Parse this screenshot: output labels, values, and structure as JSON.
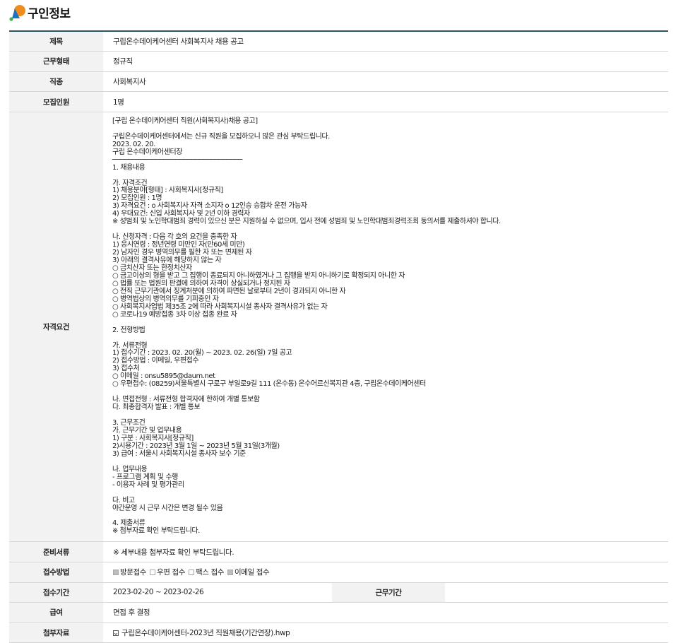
{
  "page": {
    "title": "구인정보"
  },
  "colors": {
    "header_border": "#2f5563",
    "label_bg": "#f2f2f2",
    "logo_orange": "#f28b1e",
    "logo_blue": "#1e73be",
    "logo_green": "#3bb34a"
  },
  "job": {
    "title_label": "제목",
    "title_value": "구립온수데이케어센터 사회복지사 채용 공고",
    "work_type_label": "근무형태",
    "work_type_value": "정규직",
    "occupation_label": "직종",
    "occupation_value": "사회복지사",
    "headcount_label": "모집인원",
    "headcount_value": "1명",
    "qualification_label": "자격요건",
    "qualification_text": "[구립 온수데이케어센터 직원(사회복지사)채용 공고]\n\n구립온수데이케어센터에서는 신규 직원을 모집하오니 많은 관심 부탁드립니다.\n2023. 02. 20.\n구립 온수데이케어센터장\n─────────────────────────────────\n1. 채용내용\n\n가. 자격조건\n1) 채용분야[형태] : 사회복지사[정규직]\n2) 모집인원 : 1명\n3) 자격요건 : o 사회복지사 자격 소지자 o 12인승 승합차 운전 가능자\n4) 우대요건: 신입 사회복지사 및 2년 이하 경력자\n※ 성범죄 및 노인학대범죄 경력이 있으신 분은 지원하실 수 없으며, 입사 전에 성범죄 및 노인학대범죄경력조회 동의서를 제출하셔야 합니다.\n\n나. 신청자격 : 다음 각 호의 요건을 충족한 자\n1) 응시연령 : 정년연령 미만인 자(만60세 미만)\n2) 남자인 경우 병역의무를 필한 자 또는 면제된 자\n3) 아래의 결격사유에 해당하지 않는 자\n○ 금치산자 또는 한정치산자\n○ 금고이상의 형을 받고 그 집행이 종료되지 아니하였거나 그 집행을 받지 아니하기로 확정되지 아니한 자\n○ 법률 또는 법원의 판결에 의하여 자격이 상실되거나 정지된 자\n○ 전직 근무기관에서 징계처분에 의하여 파면된 날로부터 2년이 경과되지 아니한 자\n○ 병역법상의 병역의무를 기피중인 자\n○ 사회복지사업법 제35조 2에 따라 사회복지시설 종사자 결격사유가 없는 자\n○ 코로나19 예방접종 3차 이상 접종 완료 자\n\n2. 전형방법\n\n가. 서류전형\n1) 접수기간 : 2023. 02. 20(월) ~ 2023. 02. 26(일) 7일 공고\n2) 접수방법 : 이메일, 우편접수\n3) 접수처\n○ 이메일 : onsu5895@daum.net\n○ 우편접수: (08259)서울특별시 구로구 부일로9길 111 (온수동) 온수어르신복지관 4층, 구립온수데이케어센터\n\n나. 면접전형 : 서류전형 합격자에 한하여 개별 통보함\n다. 최종합격자 발표 : 개별 통보\n\n3. 근무조건\n가. 근무기간 및 업무내용\n1) 구분 : 사회복지사[정규직]\n2)시용기간 : 2023년 3월 1일 ~ 2023년 5월 31일(3개월)\n3) 급여 : 서울시 사회복지시설 종사자 보수 기준\n\n나. 업무내용\n- 프로그램 계획 및 수행\n- 이용자 사례 및 평가관리\n\n다. 비고\n야간운영 시 근무 시간은 변경 될수 있음\n\n4. 제출서류\n※ 첨부자료 확인 부탁드립니다.",
    "documents_label": "준비서류",
    "documents_value": "※ 세부내용 첨부자료 확인 부탁드립니다.",
    "apply_method_label": "접수방법",
    "apply_methods": [
      {
        "label": "방문접수",
        "checked": true
      },
      {
        "label": "우편 접수",
        "checked": false
      },
      {
        "label": "팩스 접수",
        "checked": false
      },
      {
        "label": "이메일 접수",
        "checked": true
      }
    ],
    "apply_period_label": "접수기간",
    "apply_period_value": "2023-02-20 ~ 2023-02-26",
    "work_period_label": "근무기간",
    "work_period_value": "",
    "salary_label": "급여",
    "salary_value": "면접 후 결정",
    "attachment_label": "첨부자료",
    "attachment_icon": "file-icon",
    "attachment_file": "구립온수데이케어센터-2023년 직원채용(기간연장).hwp"
  }
}
